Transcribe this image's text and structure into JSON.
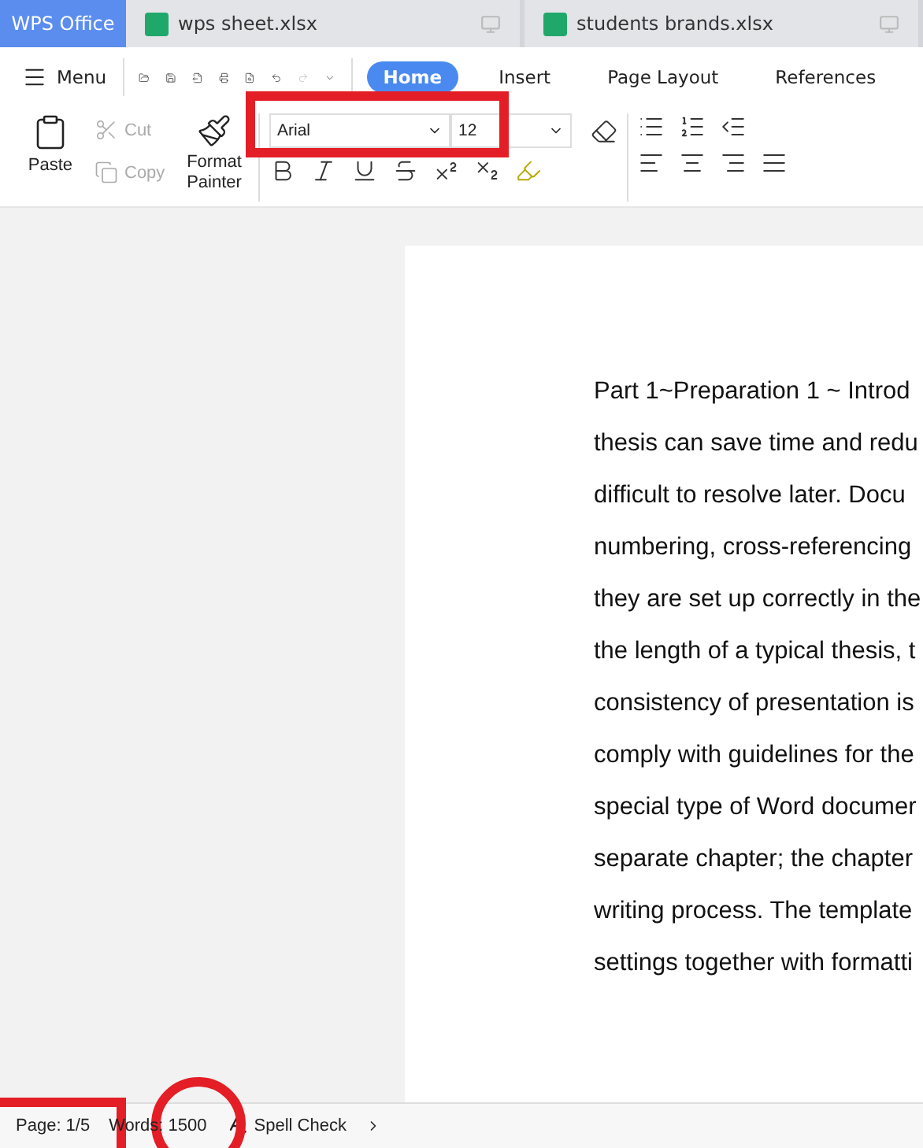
{
  "app_tab": {
    "label": "WPS Office"
  },
  "file_tabs": [
    {
      "label": "wps sheet.xlsx",
      "selected": false
    },
    {
      "label": "students brands.xlsx",
      "selected": false
    }
  ],
  "menu": {
    "label": "Menu"
  },
  "ribbon_tabs": [
    {
      "label": "Home",
      "selected": true
    },
    {
      "label": "Insert",
      "selected": false
    },
    {
      "label": "Page Layout",
      "selected": false
    },
    {
      "label": "References",
      "selected": false
    }
  ],
  "clipboard": {
    "paste": "Paste",
    "cut": "Cut",
    "copy": "Copy",
    "format_painter": "Format Painter",
    "cut_disabled": true,
    "copy_disabled": true
  },
  "font": {
    "name": "Arial",
    "size": "12"
  },
  "document_lines": [
    "Part 1~Preparation 1 ~ Introd",
    "thesis can save time and redu",
    "difficult to resolve later. Docu",
    "numbering, cross-referencing",
    "they are set up correctly in the",
    "the length of a typical thesis, t",
    "consistency of presentation is",
    "comply with guidelines for the",
    "special type of Word documer",
    "separate chapter; the chapter",
    "writing process. The template",
    "settings together with formatti"
  ],
  "status_bar": {
    "page": "Page: 1/5",
    "words": "Words: 1500",
    "spell_check": "Spell Check"
  }
}
